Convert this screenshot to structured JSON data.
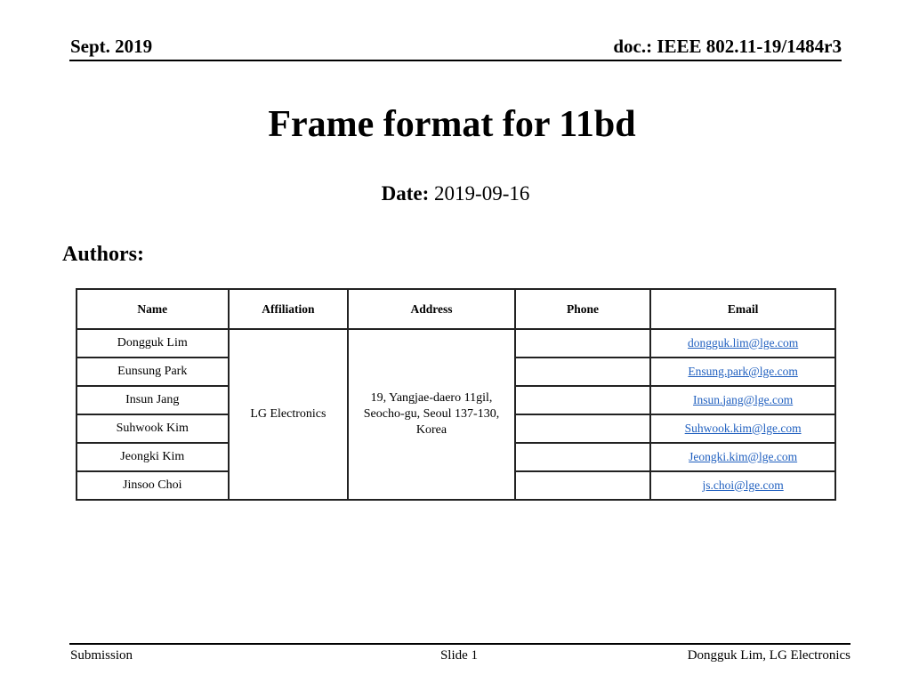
{
  "header": {
    "date": "Sept. 2019",
    "doc_id": "doc.: IEEE 802.11-19/1484r3"
  },
  "title": "Frame format for 11bd",
  "date_line": {
    "label": "Date:",
    "value": "2019-09-16"
  },
  "authors_label": "Authors:",
  "authors_table": {
    "columns": [
      "Name",
      "Affiliation",
      "Address",
      "Phone",
      "Email"
    ],
    "affiliation": "LG Electronics",
    "address": "19, Yangjae-daero 11gil, Seocho-gu, Seoul 137-130, Korea",
    "rows": [
      {
        "name": "Dongguk Lim",
        "phone": "",
        "email": "dongguk.lim@lge.com"
      },
      {
        "name": "Eunsung Park",
        "phone": "",
        "email": "Ensung.park@lge.com"
      },
      {
        "name": "Insun Jang",
        "phone": "",
        "email": "Insun.jang@lge.com"
      },
      {
        "name": "Suhwook Kim",
        "phone": "",
        "email": "Suhwook.kim@lge.com"
      },
      {
        "name": "Jeongki Kim",
        "phone": "",
        "email": "Jeongki.kim@lge.com"
      },
      {
        "name": "Jinsoo Choi",
        "phone": "",
        "email": "js.choi@lge.com"
      }
    ]
  },
  "footer": {
    "left": "Submission",
    "center": "Slide 1",
    "right": "Dongguk Lim, LG Electronics"
  },
  "colors": {
    "link": "#1f5fbf",
    "text": "#000000",
    "border": "#222222"
  }
}
